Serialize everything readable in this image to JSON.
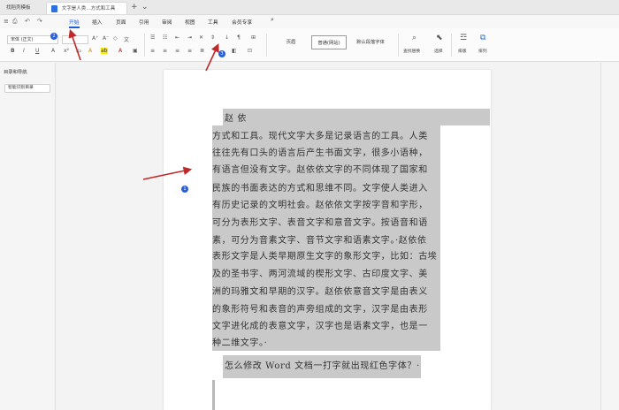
{
  "titlebar": {
    "home_tab": "找稻壳模板",
    "doc_tab": "文字是人类…方式和工具",
    "close": "×",
    "new_tab": "+",
    "dropdown": "⌄"
  },
  "menubar": {
    "quick_icons": [
      "≡",
      "⎙",
      "↶",
      "↷"
    ],
    "items": [
      "开始",
      "插入",
      "页面",
      "引用",
      "审阅",
      "视图",
      "工具",
      "会员专享"
    ],
    "active": "开始",
    "search": "⌕"
  },
  "ribbon": {
    "font_name": "宋体 (正文)",
    "font_size": "",
    "style_normal": "页眉",
    "style_selected": "普通(网站)",
    "style_default": "默认段落字体",
    "find_replace": "查找替换",
    "select": "选择",
    "layout": "排版",
    "arrange": "排列"
  },
  "leftpanel": {
    "title": "目录和导航",
    "button": "智能识别目录"
  },
  "document": {
    "lines": [
      "赵                    依",
      "方式和工具。现代文字大多是记录语言的工具。人类",
      "往往先有口头的语言后产生书面文字，很多小语种，",
      "有语言但没有文字。赵依依文字的不同体现了国家和",
      "民族的书面表达的方式和思维不同。文字使人类进入",
      "有历史记录的文明社会。赵依依文字按字音和字形，",
      "可分为表形文字、表音文字和意音文字。按语音和语",
      "素，可分为音素文字、音节文字和语素文字。·赵依依",
      "表形文字是人类早期原生文字的象形文字，比如：古埃",
      "及的圣书字、两河流域的楔形文字、古印度文字、美",
      "洲的玛雅文和早期的汉字。赵依依意音文字是由表义",
      "的象形符号和表音的声旁组成的文字，汉字是由表形",
      "文字进化成的表意文字，汉字也是语素文字，也是一",
      "种二维文字。·",
      "怎么修改 Word 文档一打字就出现红色字体？·"
    ]
  },
  "annotations": {
    "badges": [
      "2",
      "3",
      "1"
    ],
    "arrow_color": "#c0282a"
  },
  "colors": {
    "accent": "#1a5fd6",
    "highlight": "#c9c9c9",
    "arrow": "#c0282a"
  }
}
